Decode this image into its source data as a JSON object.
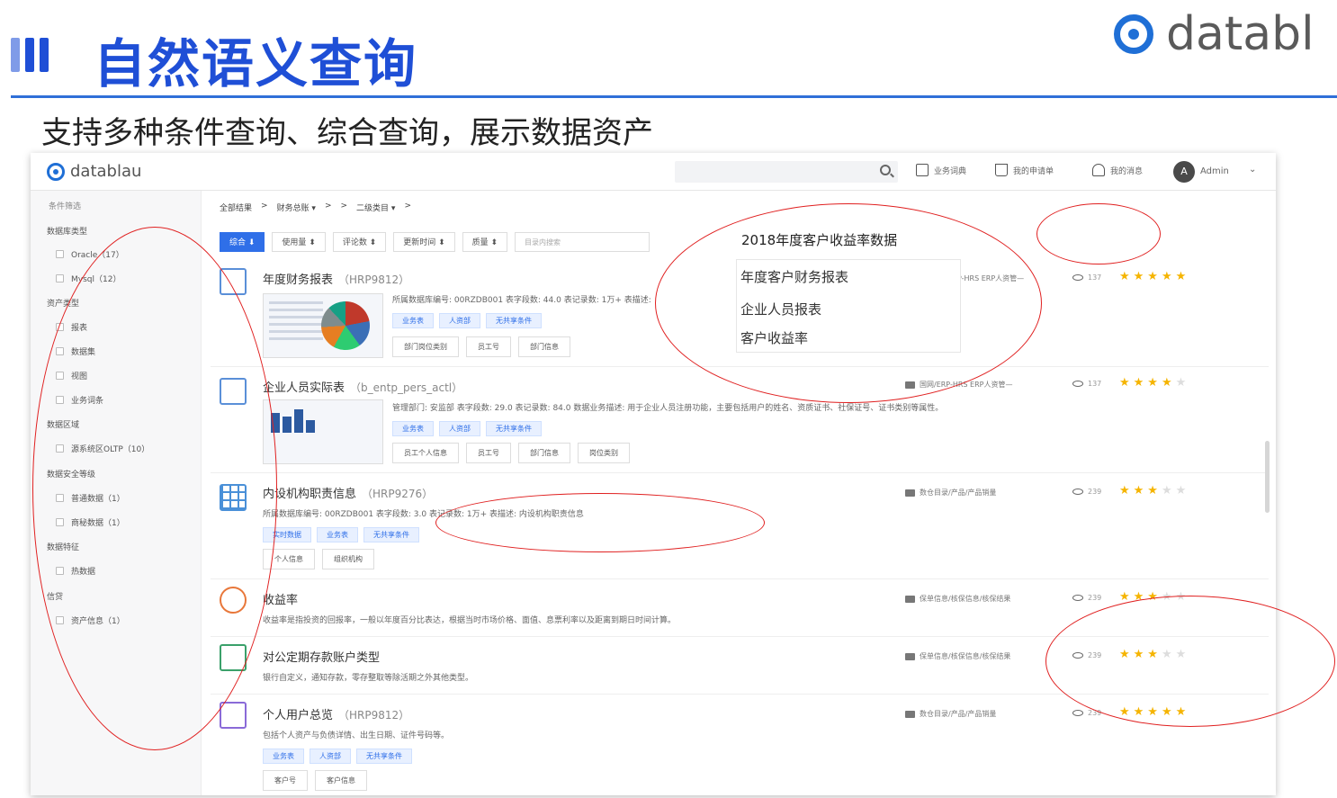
{
  "slide": {
    "title": "自然语义查询",
    "subtitle": "支持多种条件查询、综合查询，展示数据资产",
    "brand": "databl"
  },
  "topbar": {
    "logo": "datablau",
    "search_placeholder": "",
    "nav": [
      "业务词典",
      "我的申请单",
      "我的消息"
    ],
    "avatar_letter": "A",
    "user": "Admin",
    "chevron": "⌄"
  },
  "sidebar": {
    "title": "条件筛选",
    "groups": [
      {
        "label": "数据库类型",
        "items": [
          "Oracle（17）",
          "Mysql（12）"
        ]
      },
      {
        "label": "资产类型",
        "items": [
          "报表",
          "数据集",
          "视图",
          "业务词条"
        ]
      },
      {
        "label": "数据区域",
        "items": [
          "源系统区OLTP（10）"
        ]
      },
      {
        "label": "数据安全等级",
        "items": [
          "普通数据（1）",
          "商秘数据（1）"
        ]
      },
      {
        "label": "数据特征",
        "items": [
          "热数据"
        ]
      },
      {
        "label": "信贷",
        "items": [
          "资产信息（1）"
        ]
      }
    ]
  },
  "breadcrumb": [
    "全部结果",
    ">",
    "财务总账 ▾",
    ">",
    ">",
    "二级类目 ▾",
    ">"
  ],
  "filters": {
    "buttons": [
      "综合 ⬇",
      "使用量 ⬍",
      "评论数 ⬍",
      "更新时间 ⬍",
      "质量 ⬍"
    ],
    "search_placeholder": "目录内搜索"
  },
  "suggest": {
    "query": "2018年度客户收益率数据",
    "items": [
      "年度客户财务报表",
      "企业人员报表",
      "客户收益率"
    ]
  },
  "results": [
    {
      "title": "年度财务报表",
      "code": "（HRP9812）",
      "meta": "所属数据库编号: 00RZDB001  表字段数: 44.0  表记录数: 1万+  表描述:",
      "tags": [
        "业务表",
        "人资部",
        "无共享条件"
      ],
      "chips": [
        "部门岗位类别",
        "员工号",
        "部门信息"
      ],
      "folder": "P-HRS ERP人资管—",
      "views": "137",
      "stars": 5
    },
    {
      "title": "企业人员实际表",
      "code": "（b_entp_pers_actl）",
      "meta": "管理部门: 安监部  表字段数: 29.0  表记录数: 84.0  数据业务描述: 用于企业人员注册功能，主要包括用户的姓名、资质证书、社保证号、证书类别等属性。",
      "tags": [
        "业务表",
        "人资部",
        "无共享条件"
      ],
      "chips": [
        "员工个人信息",
        "员工号",
        "部门信息",
        "岗位类别"
      ],
      "folder": "国网/ERP-HRS ERP人资管—",
      "views": "137",
      "stars": 4
    },
    {
      "title": "内设机构职责信息",
      "code": "（HRP9276）",
      "meta": "所属数据库编号: 00RZDB001  表字段数: 3.0  表记录数: 1万+  表描述: 内设机构职责信息",
      "tags": [
        "实时数据",
        "业务表",
        "无共享条件"
      ],
      "chips": [
        "个人信息",
        "组织机构"
      ],
      "folder": "数仓目录/产品/产品销量",
      "views": "239",
      "stars": 3
    },
    {
      "title": "收益率",
      "code": "",
      "meta": "收益率是指投资的回报率，一般以年度百分比表达，根据当时市场价格、面值、息票利率以及距离到期日时间计算。",
      "tags": [],
      "chips": [],
      "folder": "保单信息/核保信息/核保结果",
      "views": "239",
      "stars": 3
    },
    {
      "title": "对公定期存款账户类型",
      "code": "",
      "meta": "银行自定义，通知存款，零存整取等除活期之外其他类型。",
      "tags": [],
      "chips": [],
      "folder": "保单信息/核保信息/核保结果",
      "views": "239",
      "stars": 3
    },
    {
      "title": "个人用户总览",
      "code": "（HRP9812）",
      "meta": "包括个人资产与负债详情、出生日期、证件号码等。",
      "tags": [
        "业务表",
        "人资部",
        "无共享条件"
      ],
      "chips": [
        "客户号",
        "客户信息"
      ],
      "folder": "数仓目录/产品/产品销量",
      "views": "239",
      "stars": 5
    }
  ],
  "colors": {
    "accent": "#1f4fd6",
    "primary_button": "#2f6fe8",
    "annotation": "#e02020",
    "star": "#f5b400"
  }
}
